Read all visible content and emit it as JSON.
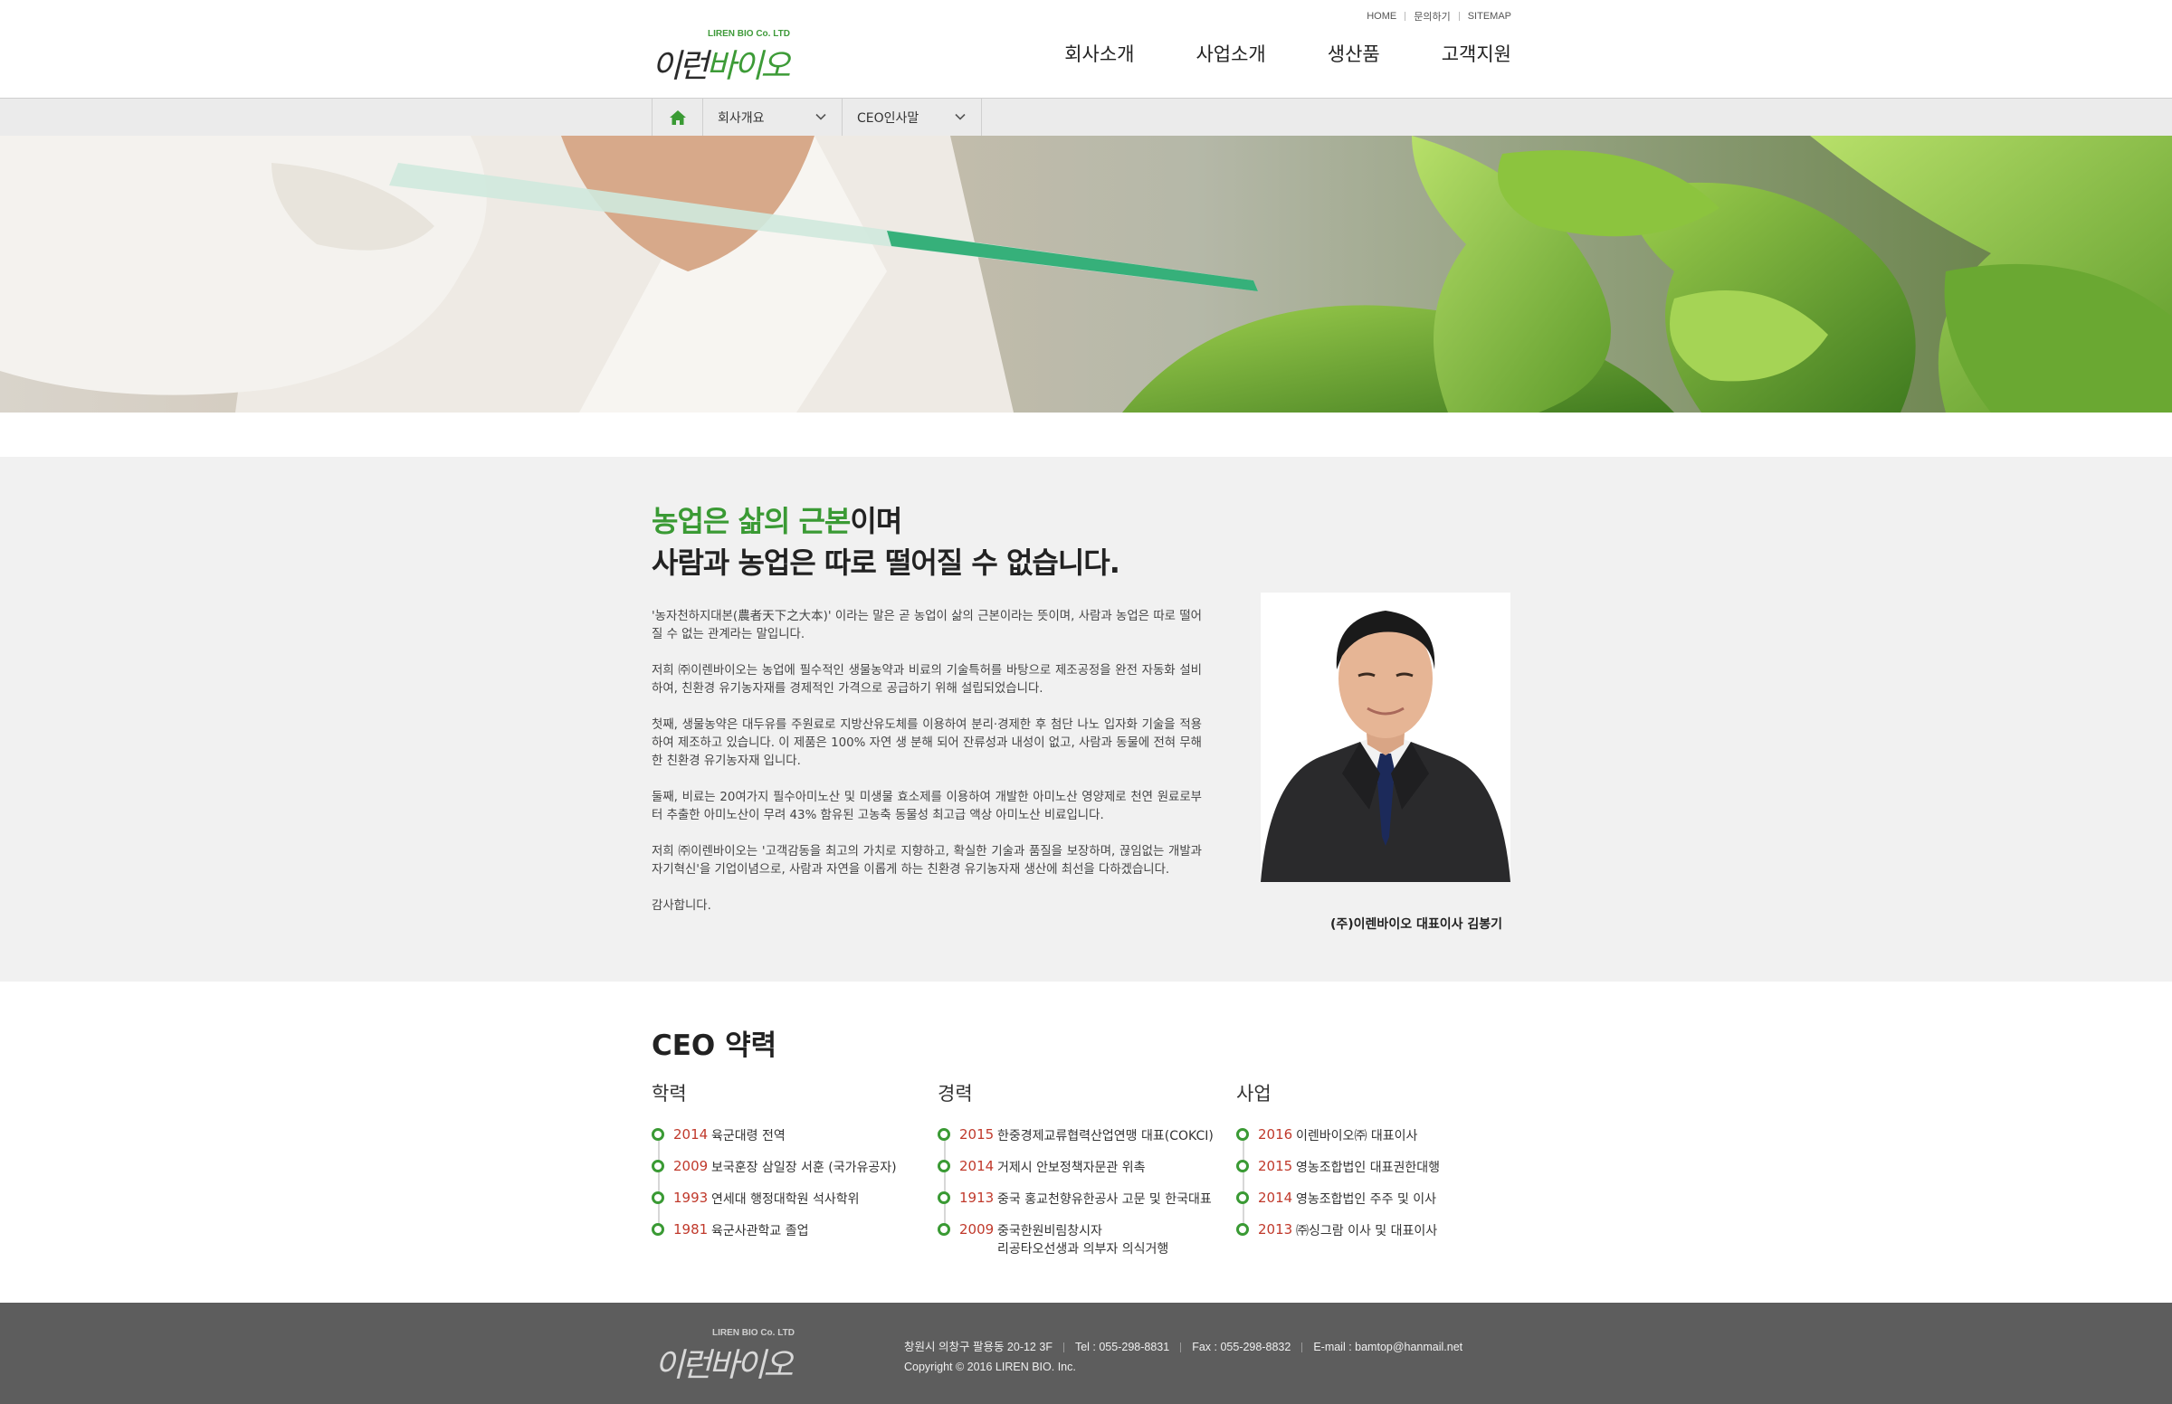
{
  "brand": {
    "logo_en": "LIREN BIO Co. LTD",
    "logo_ko_a": "이런",
    "logo_ko_b": "바이오"
  },
  "util_links": [
    "HOME",
    "문의하기",
    "SITEMAP"
  ],
  "gnb": [
    "회사소개",
    "사업소개",
    "생산품",
    "고객지원"
  ],
  "subnav": {
    "home_icon": "home-icon",
    "depth1": "회사개요",
    "depth2": "CEO인사말"
  },
  "intro": {
    "headline_green": "농업은 삶의 근본",
    "headline_rest1": "이며",
    "headline_line2": "사람과 농업은 따로 떨어질 수 없습니다.",
    "paragraphs": [
      "'농자천하지대본(農者天下之大本)' 이라는 말은 곧 농업이 삶의 근본이라는 뜻이며, 사람과 농업은 따로 떨어질 수 없는 관계라는 말입니다.",
      "저희 ㈜이렌바이오는 농업에 필수적인 생물농약과 비료의 기술특허를 바탕으로 제조공정을 완전 자동화 설비하여, 친환경 유기농자재를 경제적인 가격으로 공급하기 위해 설립되었습니다.",
      "첫째, 생물농약은 대두유를 주원료로 지방산유도체를 이용하여  분리·경제한 후 첨단 나노 입자화 기술을 적용하여 제조하고 있습니다. 이 제품은 100% 자연 생 분해 되어 잔류성과 내성이 없고, 사람과 동물에 전혀 무해한 친환경 유기농자재 입니다.",
      "둘째, 비료는 20여가지 필수아미노산 및 미생물 효소제를 이용하여 개발한 아미노산 영양제로 천연 원료로부터 추출한 아미노산이 무려 43% 함유된 고농축 동물성 최고급 액상 아미노산 비료입니다.",
      "저희 ㈜이렌바이오는 '고객감동을 최고의 가치로 지향하고, 확실한 기술과 품질을 보장하며, 끊임없는 개발과 자기혁신'을 기업이념으로, 사람과 자연을 이롭게 하는  친환경 유기농자재 생산에 최선을 다하겠습니다.",
      "감사합니다."
    ],
    "signature": "(주)이렌바이오 대표이사 김봉기"
  },
  "career": {
    "title": "CEO 약력",
    "columns": [
      {
        "title": "학력",
        "items": [
          {
            "year": "2014",
            "text": "육군대령 전역"
          },
          {
            "year": "2009",
            "text": "보국훈장 삼일장 서훈 (국가유공자)"
          },
          {
            "year": "1993",
            "text": "연세대 행정대학원 석사학위"
          },
          {
            "year": "1981",
            "text": "육군사관학교 졸업"
          }
        ]
      },
      {
        "title": "경력",
        "items": [
          {
            "year": "2015",
            "text": "한중경제교류협력산업연맹 대표(COKCI)"
          },
          {
            "year": "2014",
            "text": "거제시 안보정책자문관 위촉"
          },
          {
            "year": "1913",
            "text": "중국 홍교천향유한공사 고문 및 한국대표"
          },
          {
            "year": "2009",
            "text": "중국한원비림창시자",
            "text2": "리공타오선생과 의부자 의식거행"
          }
        ]
      },
      {
        "title": "사업",
        "items": [
          {
            "year": "2016",
            "text": "이렌바이오㈜ 대표이사"
          },
          {
            "year": "2015",
            "text": "영농조합법인 대표권한대행"
          },
          {
            "year": "2014",
            "text": "영농조합법인  주주 및 이사"
          },
          {
            "year": "2013",
            "text": "㈜싱그람 이사 및 대표이사"
          }
        ]
      }
    ]
  },
  "footer": {
    "address": "창원시 의창구 팔용동 20-12 3F",
    "tel": "Tel : 055-298-8831",
    "fax": "Fax : 055-298-8832",
    "email": "E-mail : bamtop@hanmail.net",
    "copyright": "Copyright © 2016 LIREN BIO. Inc."
  },
  "colors": {
    "accent_green": "#3a9a34",
    "year_red": "#c0392b",
    "footer_bg": "#5d5d5d",
    "intro_bg": "#f1f1f1"
  }
}
